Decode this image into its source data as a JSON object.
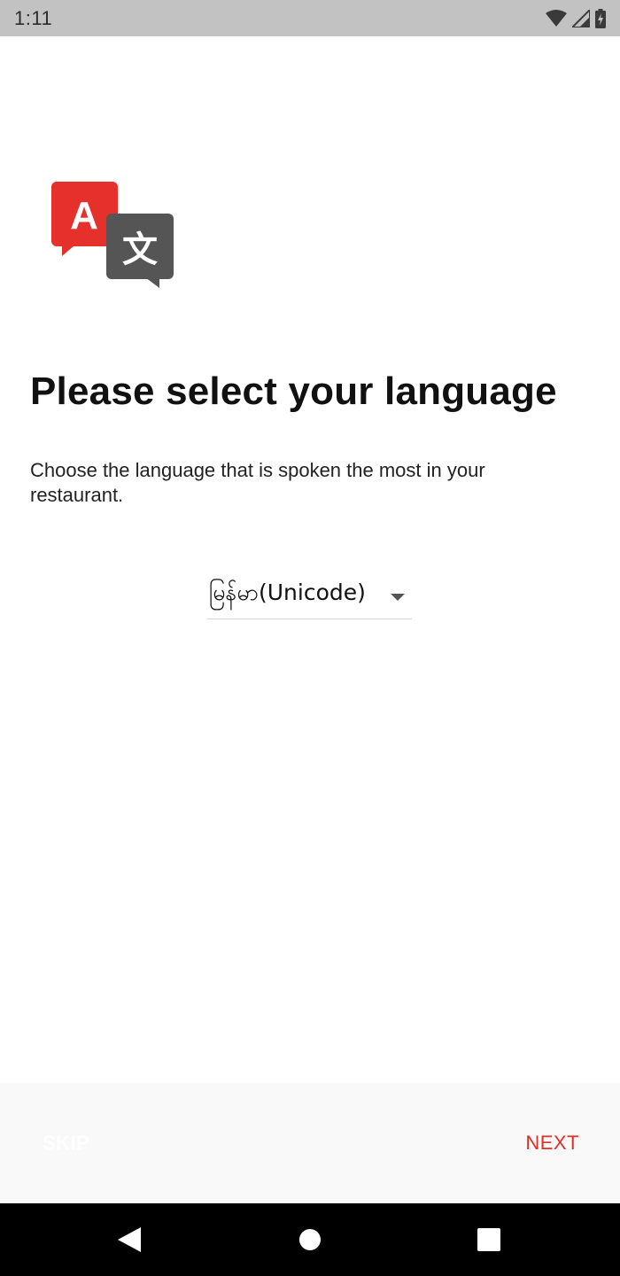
{
  "status_bar": {
    "time": "1:11",
    "icons": [
      "wifi-icon",
      "signal-icon",
      "battery-icon"
    ]
  },
  "onboarding": {
    "icon": "translate-icon",
    "icon_letters": {
      "latin": "A",
      "cjk": "文"
    },
    "title": "Please select your language",
    "subtitle": "Choose the language that is spoken the most in your restaurant.",
    "language_select": {
      "selected": "မြန်မာ(Unicode)"
    }
  },
  "footer": {
    "skip_label": "SKIP",
    "next_label": "NEXT"
  },
  "colors": {
    "accent": "#e0302a",
    "dark_icon": "#555555",
    "status_bar_bg": "#c2c2c2",
    "nav_bar_bg": "#000000"
  },
  "nav_bar": {
    "icons": [
      "back-icon",
      "home-icon",
      "recent-apps-icon"
    ]
  }
}
